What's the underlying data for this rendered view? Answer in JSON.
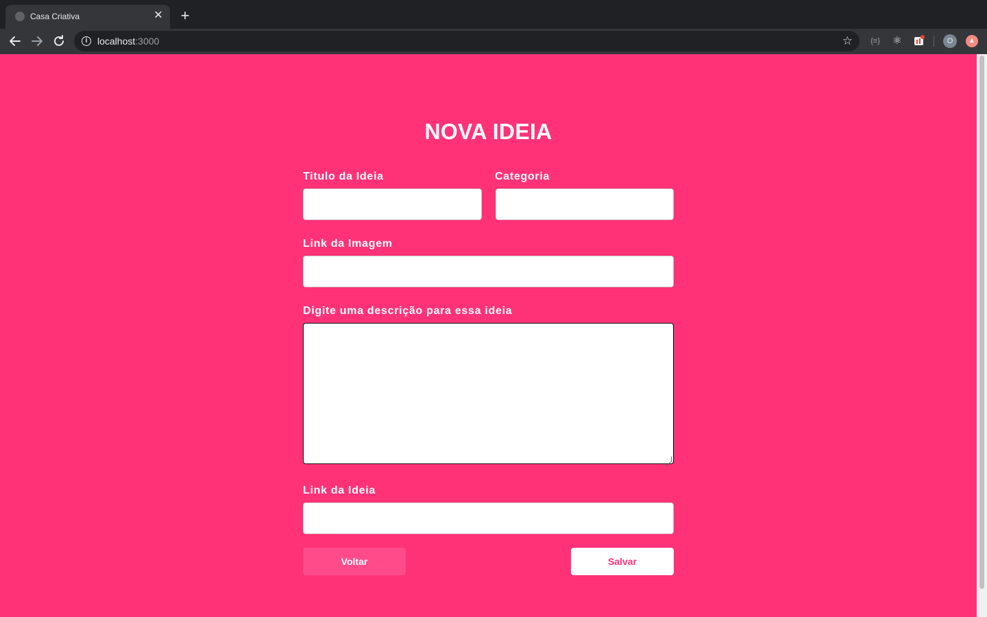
{
  "browser": {
    "tab_title": "Casa Criativa",
    "tab_close": "✕",
    "new_tab": "+",
    "url_host": "localhost",
    "url_port": ":3000",
    "profile_initial": "O",
    "ext_json_label": "{≡}"
  },
  "page": {
    "title": "NOVA IDEIA",
    "background_color": "#ff3278"
  },
  "form": {
    "title_label": "Titulo da Ideia",
    "title_value": "",
    "category_label": "Categoria",
    "category_value": "",
    "image_label": "Link da Imagem",
    "image_value": "",
    "description_label": "Digite uma descrição para essa ideia",
    "description_value": "",
    "link_label": "Link da Ideia",
    "link_value": "",
    "back_button": "Voltar",
    "save_button": "Salvar"
  },
  "icons": {
    "back": "arrow-left-icon",
    "forward": "arrow-right-icon",
    "reload": "reload-icon",
    "info": "info-icon",
    "star": "star-icon",
    "react": "react-devtools-icon"
  }
}
